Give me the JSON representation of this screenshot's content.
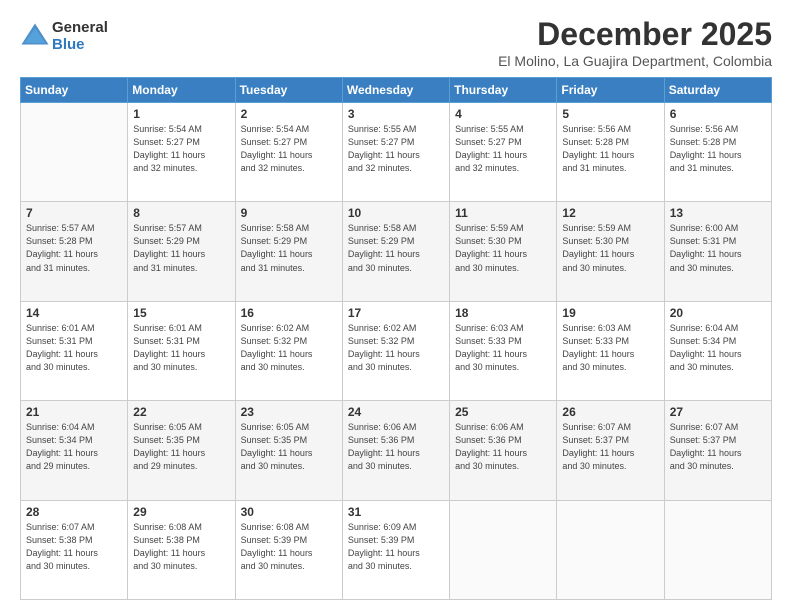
{
  "logo": {
    "general": "General",
    "blue": "Blue"
  },
  "header": {
    "title": "December 2025",
    "subtitle": "El Molino, La Guajira Department, Colombia"
  },
  "days": [
    "Sunday",
    "Monday",
    "Tuesday",
    "Wednesday",
    "Thursday",
    "Friday",
    "Saturday"
  ],
  "weeks": [
    [
      {
        "num": "",
        "info": ""
      },
      {
        "num": "1",
        "info": "Sunrise: 5:54 AM\nSunset: 5:27 PM\nDaylight: 11 hours\nand 32 minutes."
      },
      {
        "num": "2",
        "info": "Sunrise: 5:54 AM\nSunset: 5:27 PM\nDaylight: 11 hours\nand 32 minutes."
      },
      {
        "num": "3",
        "info": "Sunrise: 5:55 AM\nSunset: 5:27 PM\nDaylight: 11 hours\nand 32 minutes."
      },
      {
        "num": "4",
        "info": "Sunrise: 5:55 AM\nSunset: 5:27 PM\nDaylight: 11 hours\nand 32 minutes."
      },
      {
        "num": "5",
        "info": "Sunrise: 5:56 AM\nSunset: 5:28 PM\nDaylight: 11 hours\nand 31 minutes."
      },
      {
        "num": "6",
        "info": "Sunrise: 5:56 AM\nSunset: 5:28 PM\nDaylight: 11 hours\nand 31 minutes."
      }
    ],
    [
      {
        "num": "7",
        "info": "Sunrise: 5:57 AM\nSunset: 5:28 PM\nDaylight: 11 hours\nand 31 minutes."
      },
      {
        "num": "8",
        "info": "Sunrise: 5:57 AM\nSunset: 5:29 PM\nDaylight: 11 hours\nand 31 minutes."
      },
      {
        "num": "9",
        "info": "Sunrise: 5:58 AM\nSunset: 5:29 PM\nDaylight: 11 hours\nand 31 minutes."
      },
      {
        "num": "10",
        "info": "Sunrise: 5:58 AM\nSunset: 5:29 PM\nDaylight: 11 hours\nand 30 minutes."
      },
      {
        "num": "11",
        "info": "Sunrise: 5:59 AM\nSunset: 5:30 PM\nDaylight: 11 hours\nand 30 minutes."
      },
      {
        "num": "12",
        "info": "Sunrise: 5:59 AM\nSunset: 5:30 PM\nDaylight: 11 hours\nand 30 minutes."
      },
      {
        "num": "13",
        "info": "Sunrise: 6:00 AM\nSunset: 5:31 PM\nDaylight: 11 hours\nand 30 minutes."
      }
    ],
    [
      {
        "num": "14",
        "info": "Sunrise: 6:01 AM\nSunset: 5:31 PM\nDaylight: 11 hours\nand 30 minutes."
      },
      {
        "num": "15",
        "info": "Sunrise: 6:01 AM\nSunset: 5:31 PM\nDaylight: 11 hours\nand 30 minutes."
      },
      {
        "num": "16",
        "info": "Sunrise: 6:02 AM\nSunset: 5:32 PM\nDaylight: 11 hours\nand 30 minutes."
      },
      {
        "num": "17",
        "info": "Sunrise: 6:02 AM\nSunset: 5:32 PM\nDaylight: 11 hours\nand 30 minutes."
      },
      {
        "num": "18",
        "info": "Sunrise: 6:03 AM\nSunset: 5:33 PM\nDaylight: 11 hours\nand 30 minutes."
      },
      {
        "num": "19",
        "info": "Sunrise: 6:03 AM\nSunset: 5:33 PM\nDaylight: 11 hours\nand 30 minutes."
      },
      {
        "num": "20",
        "info": "Sunrise: 6:04 AM\nSunset: 5:34 PM\nDaylight: 11 hours\nand 30 minutes."
      }
    ],
    [
      {
        "num": "21",
        "info": "Sunrise: 6:04 AM\nSunset: 5:34 PM\nDaylight: 11 hours\nand 29 minutes."
      },
      {
        "num": "22",
        "info": "Sunrise: 6:05 AM\nSunset: 5:35 PM\nDaylight: 11 hours\nand 29 minutes."
      },
      {
        "num": "23",
        "info": "Sunrise: 6:05 AM\nSunset: 5:35 PM\nDaylight: 11 hours\nand 30 minutes."
      },
      {
        "num": "24",
        "info": "Sunrise: 6:06 AM\nSunset: 5:36 PM\nDaylight: 11 hours\nand 30 minutes."
      },
      {
        "num": "25",
        "info": "Sunrise: 6:06 AM\nSunset: 5:36 PM\nDaylight: 11 hours\nand 30 minutes."
      },
      {
        "num": "26",
        "info": "Sunrise: 6:07 AM\nSunset: 5:37 PM\nDaylight: 11 hours\nand 30 minutes."
      },
      {
        "num": "27",
        "info": "Sunrise: 6:07 AM\nSunset: 5:37 PM\nDaylight: 11 hours\nand 30 minutes."
      }
    ],
    [
      {
        "num": "28",
        "info": "Sunrise: 6:07 AM\nSunset: 5:38 PM\nDaylight: 11 hours\nand 30 minutes."
      },
      {
        "num": "29",
        "info": "Sunrise: 6:08 AM\nSunset: 5:38 PM\nDaylight: 11 hours\nand 30 minutes."
      },
      {
        "num": "30",
        "info": "Sunrise: 6:08 AM\nSunset: 5:39 PM\nDaylight: 11 hours\nand 30 minutes."
      },
      {
        "num": "31",
        "info": "Sunrise: 6:09 AM\nSunset: 5:39 PM\nDaylight: 11 hours\nand 30 minutes."
      },
      {
        "num": "",
        "info": ""
      },
      {
        "num": "",
        "info": ""
      },
      {
        "num": "",
        "info": ""
      }
    ]
  ]
}
